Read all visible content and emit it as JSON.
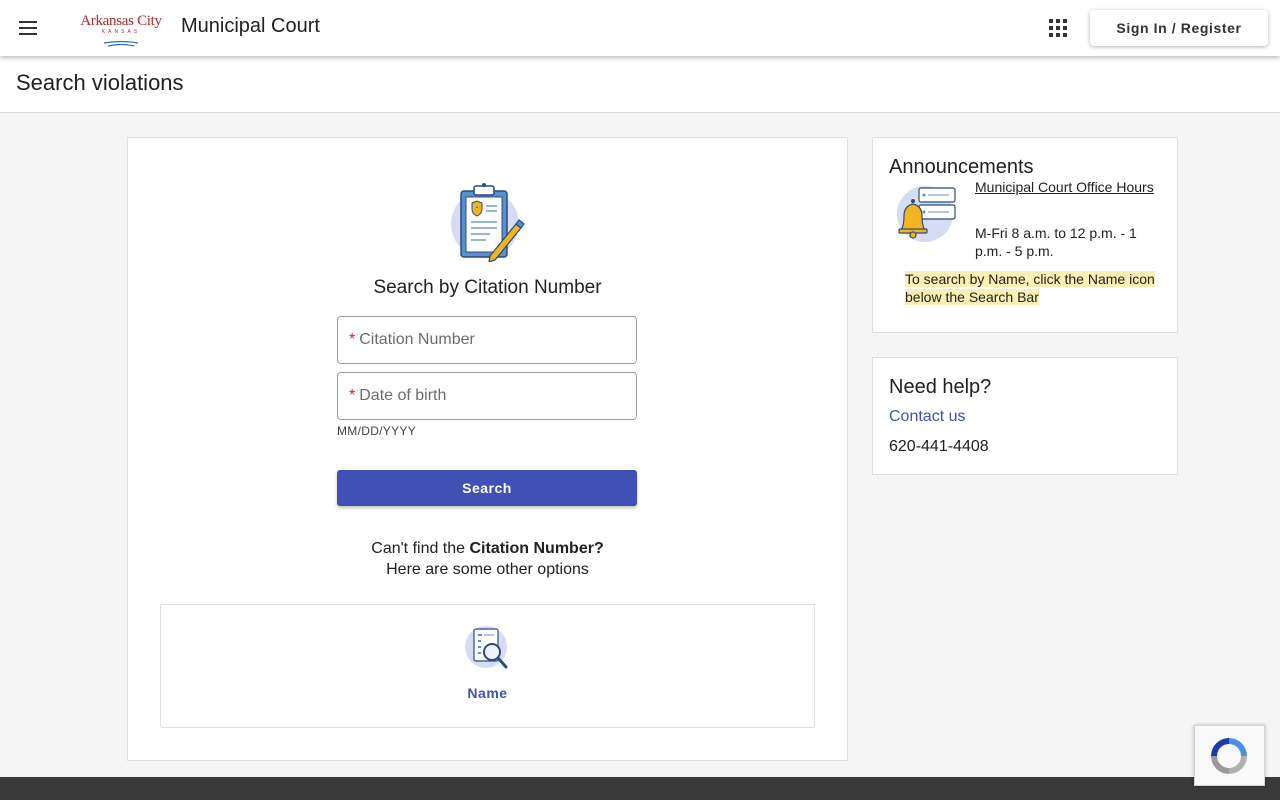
{
  "header": {
    "logo_text": "Arkansas City",
    "logo_subtext": "KANSAS",
    "app_title": "Municipal Court",
    "signin_label": "Sign In / Register"
  },
  "page": {
    "title": "Search violations"
  },
  "search": {
    "heading": "Search by Citation Number",
    "citation_placeholder": "Citation Number",
    "dob_placeholder": "Date of birth",
    "dob_hint": "MM/DD/YYYY",
    "required_marker": "*",
    "button_label": "Search",
    "cant_find_prefix": "Can't find the",
    "cant_find_bold": "Citation Number?",
    "cant_find_line2": "Here are some other options",
    "option_name_label": "Name"
  },
  "announcements": {
    "title": "Announcements",
    "link_label": "Municipal Court Office Hours",
    "hours": "M-Fri 8 a.m. to 12 p.m. - 1 p.m. - 5 p.m.",
    "note": "To search by Name, click the Name icon below the Search Bar"
  },
  "help": {
    "title": "Need help?",
    "contact_label": "Contact us",
    "phone": "620-441-4408"
  },
  "colors": {
    "primary": "#3f51b5",
    "required": "#c62828",
    "highlight": "#fcefb4",
    "footer": "#3a3a3a",
    "logo_red": "#b02a30"
  },
  "icons": {
    "menu": "hamburger-menu-icon",
    "apps": "apps-grid-icon",
    "clipboard": "clipboard-badge-pencil-icon",
    "name_search": "document-magnifier-icon",
    "bell": "bell-notification-icon",
    "recaptcha": "recaptcha-icon"
  }
}
